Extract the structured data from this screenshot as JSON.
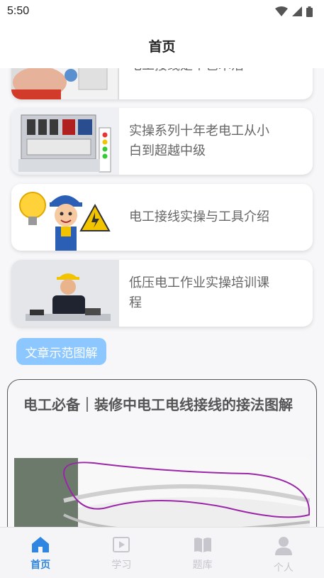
{
  "status_bar": {
    "time": "5:50",
    "icons": [
      "wifi-icon",
      "signal-icon",
      "battery-icon"
    ]
  },
  "header": {
    "title": "首页"
  },
  "courses": [
    {
      "title": "电工接线是个艺术活"
    },
    {
      "title": "实操系列十年老电工从小白到超越中级"
    },
    {
      "title": "电工接线实操与工具介绍"
    },
    {
      "title": "低压电工作业实操培训课程"
    }
  ],
  "section_tag": {
    "label": "文章示范图解"
  },
  "article": {
    "title": "电工必备｜装修中电工电线接线的接法图解"
  },
  "tab_bar": {
    "tabs": [
      {
        "label": "首页",
        "icon": "home-icon",
        "active": true
      },
      {
        "label": "学习",
        "icon": "video-play-icon",
        "active": false
      },
      {
        "label": "题库",
        "icon": "book-icon",
        "active": false
      },
      {
        "label": "个人",
        "icon": "user-icon",
        "active": false
      }
    ]
  },
  "colors": {
    "accent": "#2f86e0",
    "tag_background": "#8cc8ff",
    "inactive_tab": "#c6c6cc",
    "page_background": "#f7f7f9"
  }
}
